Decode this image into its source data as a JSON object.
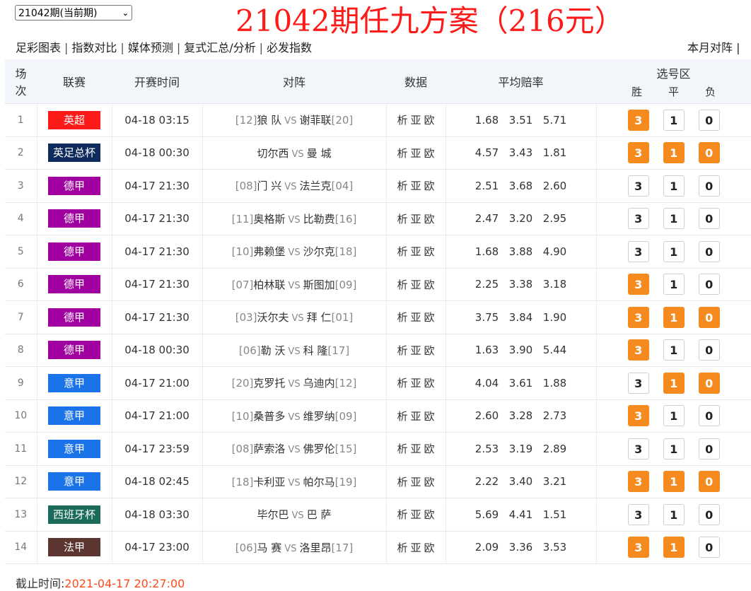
{
  "period_select": {
    "value": "21042期(当前期)"
  },
  "title": "21042期任九方案（216元）",
  "nav": [
    "足彩图表",
    "指数对比",
    "媒体预测",
    "复式汇总/分析",
    "必发指数"
  ],
  "nav_right": "本月对阵",
  "headers": {
    "idx": "场次",
    "idx_top": "场",
    "idx_bottom": "次",
    "league": "联赛",
    "time": "开赛时间",
    "match": "对阵",
    "data": "数据",
    "odds": "平均赔率",
    "pick": "选号区",
    "pick_sub": [
      "胜",
      "平",
      "负"
    ]
  },
  "data_links": [
    "析",
    "亚",
    "欧"
  ],
  "vs_label": "VS",
  "colors": {
    "accent": "#f58a1f",
    "title_red": "#ff1a1a"
  },
  "rows": [
    {
      "idx": "1",
      "league": "英超",
      "league_color": "#ff1a1a",
      "time": "04-18 03:15",
      "home_rank": "[12]",
      "home": "狼 队",
      "away": "谢菲联",
      "away_rank": "[20]",
      "odds": [
        "1.68",
        "3.51",
        "5.71"
      ],
      "picks": [
        {
          "label": "3",
          "on": true
        },
        {
          "label": "1",
          "on": false
        },
        {
          "label": "0",
          "on": false
        }
      ]
    },
    {
      "idx": "2",
      "league": "英足总杯",
      "league_color": "#0f2a5c",
      "time": "04-18 00:30",
      "home_rank": "",
      "home": "切尔西",
      "away": "曼 城",
      "away_rank": "",
      "odds": [
        "4.57",
        "3.43",
        "1.81"
      ],
      "picks": [
        {
          "label": "3",
          "on": true
        },
        {
          "label": "1",
          "on": true
        },
        {
          "label": "0",
          "on": true
        }
      ]
    },
    {
      "idx": "3",
      "league": "德甲",
      "league_color": "#a000a0",
      "time": "04-17 21:30",
      "home_rank": "[08]",
      "home": "门 兴",
      "away": "法兰克",
      "away_rank": "[04]",
      "odds": [
        "2.51",
        "3.68",
        "2.60"
      ],
      "picks": [
        {
          "label": "3",
          "on": false
        },
        {
          "label": "1",
          "on": false
        },
        {
          "label": "0",
          "on": false
        }
      ]
    },
    {
      "idx": "4",
      "league": "德甲",
      "league_color": "#a000a0",
      "time": "04-17 21:30",
      "home_rank": "[11]",
      "home": "奥格斯",
      "away": "比勒费",
      "away_rank": "[16]",
      "odds": [
        "2.47",
        "3.20",
        "2.95"
      ],
      "picks": [
        {
          "label": "3",
          "on": false
        },
        {
          "label": "1",
          "on": false
        },
        {
          "label": "0",
          "on": false
        }
      ]
    },
    {
      "idx": "5",
      "league": "德甲",
      "league_color": "#a000a0",
      "time": "04-17 21:30",
      "home_rank": "[10]",
      "home": "弗赖堡",
      "away": "沙尔克",
      "away_rank": "[18]",
      "odds": [
        "1.68",
        "3.88",
        "4.90"
      ],
      "picks": [
        {
          "label": "3",
          "on": false
        },
        {
          "label": "1",
          "on": false
        },
        {
          "label": "0",
          "on": false
        }
      ]
    },
    {
      "idx": "6",
      "league": "德甲",
      "league_color": "#a000a0",
      "time": "04-17 21:30",
      "home_rank": "[07]",
      "home": "柏林联",
      "away": "斯图加",
      "away_rank": "[09]",
      "odds": [
        "2.25",
        "3.38",
        "3.18"
      ],
      "picks": [
        {
          "label": "3",
          "on": true
        },
        {
          "label": "1",
          "on": false
        },
        {
          "label": "0",
          "on": false
        }
      ]
    },
    {
      "idx": "7",
      "league": "德甲",
      "league_color": "#a000a0",
      "time": "04-17 21:30",
      "home_rank": "[03]",
      "home": "沃尔夫",
      "away": "拜 仁",
      "away_rank": "[01]",
      "odds": [
        "3.75",
        "3.84",
        "1.90"
      ],
      "picks": [
        {
          "label": "3",
          "on": true
        },
        {
          "label": "1",
          "on": true
        },
        {
          "label": "0",
          "on": true
        }
      ]
    },
    {
      "idx": "8",
      "league": "德甲",
      "league_color": "#a000a0",
      "time": "04-18 00:30",
      "home_rank": "[06]",
      "home": "勒 沃",
      "away": "科 隆",
      "away_rank": "[17]",
      "odds": [
        "1.63",
        "3.90",
        "5.44"
      ],
      "picks": [
        {
          "label": "3",
          "on": true
        },
        {
          "label": "1",
          "on": false
        },
        {
          "label": "0",
          "on": false
        }
      ]
    },
    {
      "idx": "9",
      "league": "意甲",
      "league_color": "#1a73e8",
      "time": "04-17 21:00",
      "home_rank": "[20]",
      "home": "克罗托",
      "away": "乌迪内",
      "away_rank": "[12]",
      "odds": [
        "4.04",
        "3.61",
        "1.88"
      ],
      "picks": [
        {
          "label": "3",
          "on": false
        },
        {
          "label": "1",
          "on": true
        },
        {
          "label": "0",
          "on": true
        }
      ]
    },
    {
      "idx": "10",
      "league": "意甲",
      "league_color": "#1a73e8",
      "time": "04-17 21:00",
      "home_rank": "[10]",
      "home": "桑普多",
      "away": "维罗纳",
      "away_rank": "[09]",
      "odds": [
        "2.60",
        "3.28",
        "2.73"
      ],
      "picks": [
        {
          "label": "3",
          "on": true
        },
        {
          "label": "1",
          "on": false
        },
        {
          "label": "0",
          "on": false
        }
      ]
    },
    {
      "idx": "11",
      "league": "意甲",
      "league_color": "#1a73e8",
      "time": "04-17 23:59",
      "home_rank": "[08]",
      "home": "萨索洛",
      "away": "佛罗伦",
      "away_rank": "[15]",
      "odds": [
        "2.53",
        "3.19",
        "2.89"
      ],
      "picks": [
        {
          "label": "3",
          "on": false
        },
        {
          "label": "1",
          "on": false
        },
        {
          "label": "0",
          "on": false
        }
      ]
    },
    {
      "idx": "12",
      "league": "意甲",
      "league_color": "#1a73e8",
      "time": "04-18 02:45",
      "home_rank": "[18]",
      "home": "卡利亚",
      "away": "帕尔马",
      "away_rank": "[19]",
      "odds": [
        "2.22",
        "3.40",
        "3.21"
      ],
      "picks": [
        {
          "label": "3",
          "on": true
        },
        {
          "label": "1",
          "on": true
        },
        {
          "label": "0",
          "on": true
        }
      ]
    },
    {
      "idx": "13",
      "league": "西班牙杯",
      "league_color": "#1a6b5a",
      "time": "04-18 03:30",
      "home_rank": "",
      "home": "毕尔巴",
      "away": "巴 萨",
      "away_rank": "",
      "odds": [
        "5.69",
        "4.41",
        "1.51"
      ],
      "picks": [
        {
          "label": "3",
          "on": false
        },
        {
          "label": "1",
          "on": false
        },
        {
          "label": "0",
          "on": false
        }
      ]
    },
    {
      "idx": "14",
      "league": "法甲",
      "league_color": "#5c3530",
      "time": "04-17 23:00",
      "home_rank": "[06]",
      "home": "马 赛",
      "away": "洛里昂",
      "away_rank": "[17]",
      "odds": [
        "2.09",
        "3.36",
        "3.53"
      ],
      "picks": [
        {
          "label": "3",
          "on": true
        },
        {
          "label": "1",
          "on": true
        },
        {
          "label": "0",
          "on": false
        }
      ]
    }
  ],
  "footer": {
    "label": "截止时间:",
    "value": "2021-04-17 20:27:00"
  }
}
